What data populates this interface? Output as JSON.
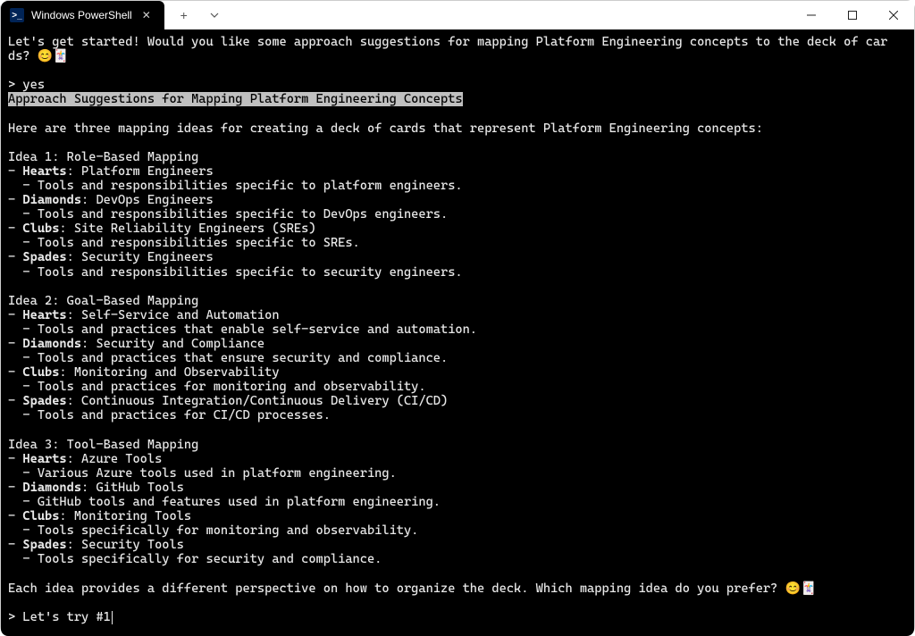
{
  "titlebar": {
    "tab_title": "Windows PowerShell"
  },
  "terminal": {
    "intro1": "Let's get started! Would you like some approach suggestions for mapping Platform Engineering concepts to the deck of car",
    "intro2": "ds? 😊🃏",
    "prompt1": "> yes",
    "heading_hl": "Approach Suggestions for Mapping Platform Engineering Concepts",
    "intro3": "Here are three mapping ideas for creating a deck of cards that represent Platform Engineering concepts:",
    "idea1_title": "Idea 1: Role-Based Mapping",
    "i1_h_label": "Hearts",
    "i1_h_rest": ": Platform Engineers",
    "i1_h_sub": "  - Tools and responsibilities specific to platform engineers.",
    "i1_d_label": "Diamonds",
    "i1_d_rest": ": DevOps Engineers",
    "i1_d_sub": "  - Tools and responsibilities specific to DevOps engineers.",
    "i1_c_label": "Clubs",
    "i1_c_rest": ": Site Reliability Engineers (SREs)",
    "i1_c_sub": "  - Tools and responsibilities specific to SREs.",
    "i1_s_label": "Spades",
    "i1_s_rest": ": Security Engineers",
    "i1_s_sub": "  - Tools and responsibilities specific to security engineers.",
    "idea2_title": "Idea 2: Goal-Based Mapping",
    "i2_h_label": "Hearts",
    "i2_h_rest": ": Self-Service and Automation",
    "i2_h_sub": "  - Tools and practices that enable self-service and automation.",
    "i2_d_label": "Diamonds",
    "i2_d_rest": ": Security and Compliance",
    "i2_d_sub": "  - Tools and practices that ensure security and compliance.",
    "i2_c_label": "Clubs",
    "i2_c_rest": ": Monitoring and Observability",
    "i2_c_sub": "  - Tools and practices for monitoring and observability.",
    "i2_s_label": "Spades",
    "i2_s_rest": ": Continuous Integration/Continuous Delivery (CI/CD)",
    "i2_s_sub": "  - Tools and practices for CI/CD processes.",
    "idea3_title": "Idea 3: Tool-Based Mapping",
    "i3_h_label": "Hearts",
    "i3_h_rest": ": Azure Tools",
    "i3_h_sub": "  - Various Azure tools used in platform engineering.",
    "i3_d_label": "Diamonds",
    "i3_d_rest": ": GitHub Tools",
    "i3_d_sub": "  - GitHub tools and features used in platform engineering.",
    "i3_c_label": "Clubs",
    "i3_c_rest": ": Monitoring Tools",
    "i3_c_sub": "  - Tools specifically for monitoring and observability.",
    "i3_s_label": "Spades",
    "i3_s_rest": ": Security Tools",
    "i3_s_sub": "  - Tools specifically for security and compliance.",
    "closing": "Each idea provides a different perspective on how to organize the deck. Which mapping idea do you prefer? 😊🃏",
    "prompt2": "> Let's try #1"
  }
}
